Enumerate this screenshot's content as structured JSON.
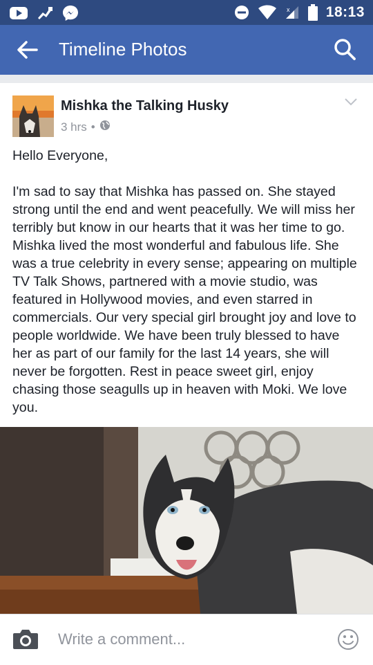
{
  "status_bar": {
    "time": "18:13",
    "left_icons": [
      "youtube-icon",
      "fb-icon",
      "messenger-icon"
    ],
    "right_icons": [
      "do-not-disturb-icon",
      "wifi-icon",
      "signal-icon",
      "battery-icon"
    ]
  },
  "app_bar": {
    "title": "Timeline Photos",
    "back_icon": "arrow-left-icon",
    "search_icon": "search-icon"
  },
  "post": {
    "author": "Mishka the Talking Husky",
    "time": "3 hrs",
    "separator": "•",
    "privacy_icon": "globe-icon",
    "greeting": "Hello Everyone,",
    "body": "I'm sad to say that Mishka has passed on. She stayed strong until the end and went peacefully. We will miss her terribly but know in our hearts that it was her time to go. Mishka lived the most wonderful and fabulous life. She was a true celebrity in every sense; appearing on multiple TV Talk Shows, partnered with a movie studio, was featured in Hollywood movies, and even starred in commercials. Our very special girl brought joy and love to people worldwide. We have been truly blessed to have her as part of our family for the last 14 years, she will never be forgotten. Rest in peace sweet girl, enjoy chasing those seagulls up in heaven with Moki. We love you."
  },
  "comment_bar": {
    "placeholder": "Write a comment..."
  },
  "colors": {
    "status_bar": "#2e4a80",
    "app_bar": "#4267b2",
    "background": "#e9ebee",
    "text": "#1d2129",
    "muted": "#90949c"
  }
}
